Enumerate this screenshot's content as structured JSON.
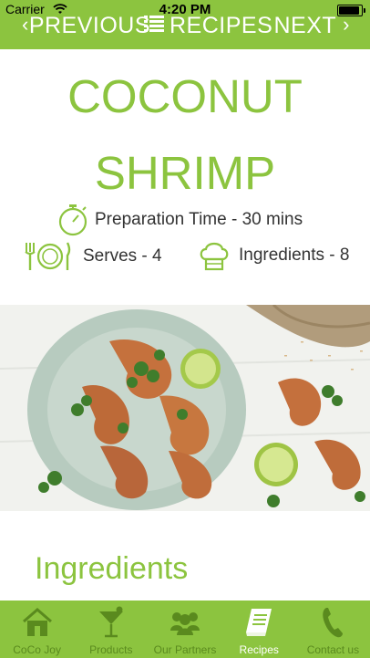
{
  "status_bar": {
    "carrier": "Carrier",
    "time": "4:20 PM",
    "battery_level": 0.9
  },
  "nav": {
    "previous": "PREVIOUS",
    "recipes": "RECIPES",
    "next": "NEXT",
    "icons": [
      "chevron-left-icon",
      "list-icon",
      "chevron-right-icon"
    ]
  },
  "recipe": {
    "title_line1": "COCONUT",
    "title_line2": "SHRIMP",
    "prep_time": "Preparation Time - 30 mins",
    "serves": "Serves - 4",
    "ingredients_count": "Ingredients - 8",
    "section_ingredients": "Ingredients"
  },
  "tabbar": {
    "items": [
      {
        "label": "CoCo Joy",
        "icon": "house-icon",
        "active": false
      },
      {
        "label": "Products",
        "icon": "cocktail-icon",
        "active": false
      },
      {
        "label": "Our Partners",
        "icon": "people-icon",
        "active": false
      },
      {
        "label": "Recipes",
        "icon": "book-icon",
        "active": true
      },
      {
        "label": "Contact us",
        "icon": "phone-icon",
        "active": false
      }
    ]
  },
  "colors": {
    "brand_green": "#8cc43f",
    "tab_inactive": "#5a8a1e",
    "text_dark": "#333333"
  }
}
